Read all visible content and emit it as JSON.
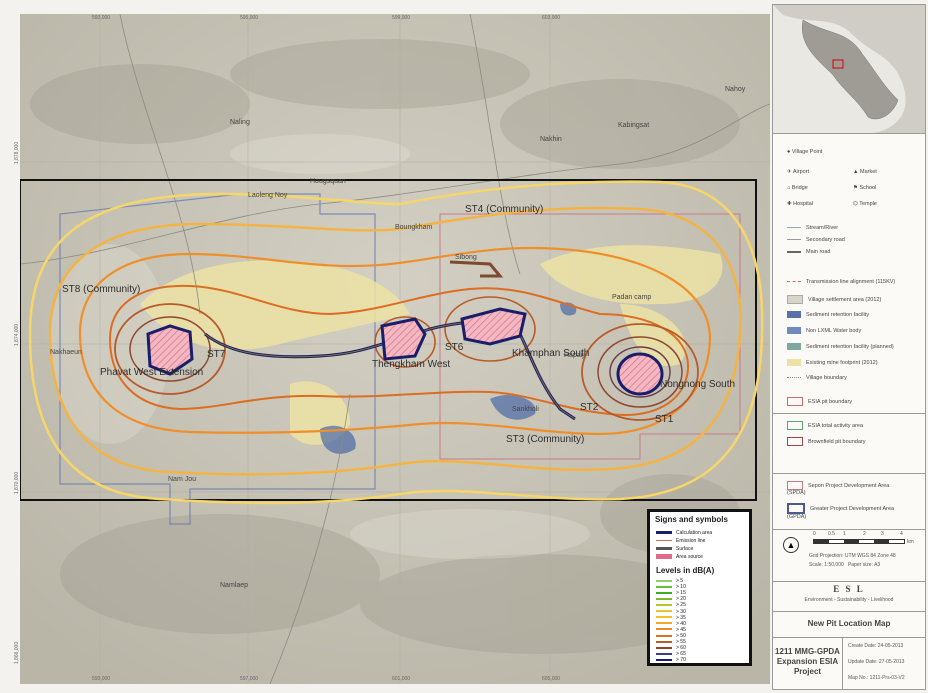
{
  "map": {
    "grid_x": [
      "593,000",
      "597,000",
      "601,000",
      "605,000"
    ],
    "grid_x_top": [
      "595,000",
      "599,000",
      "603,000",
      "607,000"
    ],
    "grid_y": [
      "1,878,000",
      "1,874,000",
      "1,870,000",
      "1,866,000"
    ],
    "big_labels": [
      "ST8 (Community)",
      "ST4 (Community)",
      "ST3 (Community)",
      "Phavat West Extension",
      "Thengkham West",
      "Khamphan South",
      "Nongnong South",
      "ST6",
      "ST7",
      "ST2",
      "ST1"
    ],
    "places": [
      "Naling",
      "Kabingsat",
      "Nakhin",
      "Laoleng Noy",
      "Hougsquan",
      "Boungkham",
      "Sibong",
      "Padan camp",
      "Namlaep",
      "Nam Jou",
      "Nahoy",
      "Sankholi",
      "Nakhaeun",
      "Hapaiji"
    ]
  },
  "legend": {
    "village_point": "Village Point",
    "items_col1": [
      "Airport",
      "Bridge",
      "Hospital"
    ],
    "items_col2": [
      "Market",
      "School",
      "Temple"
    ],
    "lines": [
      "Stream/River",
      "Secondary road",
      "Main road"
    ],
    "areas": [
      "Transmission line alignment (115KV)",
      "Village settlement area (2012)",
      "Sediment retention facility",
      "Non LXML Water body",
      "Sediment retention facility (planned)",
      "Existing mine footprint (2012)",
      "Village boundary"
    ],
    "boundaries": [
      "ESIA pit boundary",
      "ESIA total activity area",
      "Brownfield pit boundary"
    ],
    "pda": [
      "Sepon Project Development Area (SPDA)",
      "Greater Project Development Area (GPDA)"
    ],
    "colors": {
      "esia_pit": "#d06b6b",
      "esia_total": "#5fa36d",
      "brownfield": "#9a4a4a",
      "spda": "#c67a90",
      "gpda": "#4a5c8f"
    }
  },
  "scale": {
    "ticks": [
      "0",
      "0.5",
      "1",
      "2",
      "3",
      "4"
    ],
    "unit": "km",
    "projection": "Grid Projection: UTM WGS 84 Zone 48",
    "scale_text": "Scale:",
    "scale_value": "1:50,000",
    "paper": "Paper size: A3"
  },
  "brand": {
    "name": "E S L",
    "tagline": "Environment - Sustainability - Livelihood"
  },
  "title": "New Pit Location Map",
  "project": {
    "line1": "1211 MMG-GPDA",
    "line2": "Expansion ESIA",
    "line3": "Project"
  },
  "meta": {
    "create": "Create Date: 24-05-2013",
    "update": "Update Date: 27-05-2013",
    "mapno": "Map No.: 1211-Prs-03-V2"
  },
  "signs": {
    "title": "Signs and symbols",
    "items": [
      "Calculation area",
      "Emission line",
      "Surface",
      "Area source"
    ],
    "levels_title": "Levels in dB(A)",
    "levels": [
      ">  5",
      ">  10",
      ">  15",
      ">  20",
      ">  25",
      ">  30",
      ">  35",
      ">  40",
      ">  45",
      ">  50",
      ">  55",
      ">  60",
      ">  65",
      ">  70"
    ],
    "level_colors": [
      "#8cd36a",
      "#62c23c",
      "#3fae2a",
      "#7bb92f",
      "#b8c52a",
      "#e2c92b",
      "#f2c22d",
      "#f4a82c",
      "#ee8a28",
      "#dd6d22",
      "#b85a2a",
      "#8e4730",
      "#3b3f84",
      "#1a1e6a"
    ]
  }
}
